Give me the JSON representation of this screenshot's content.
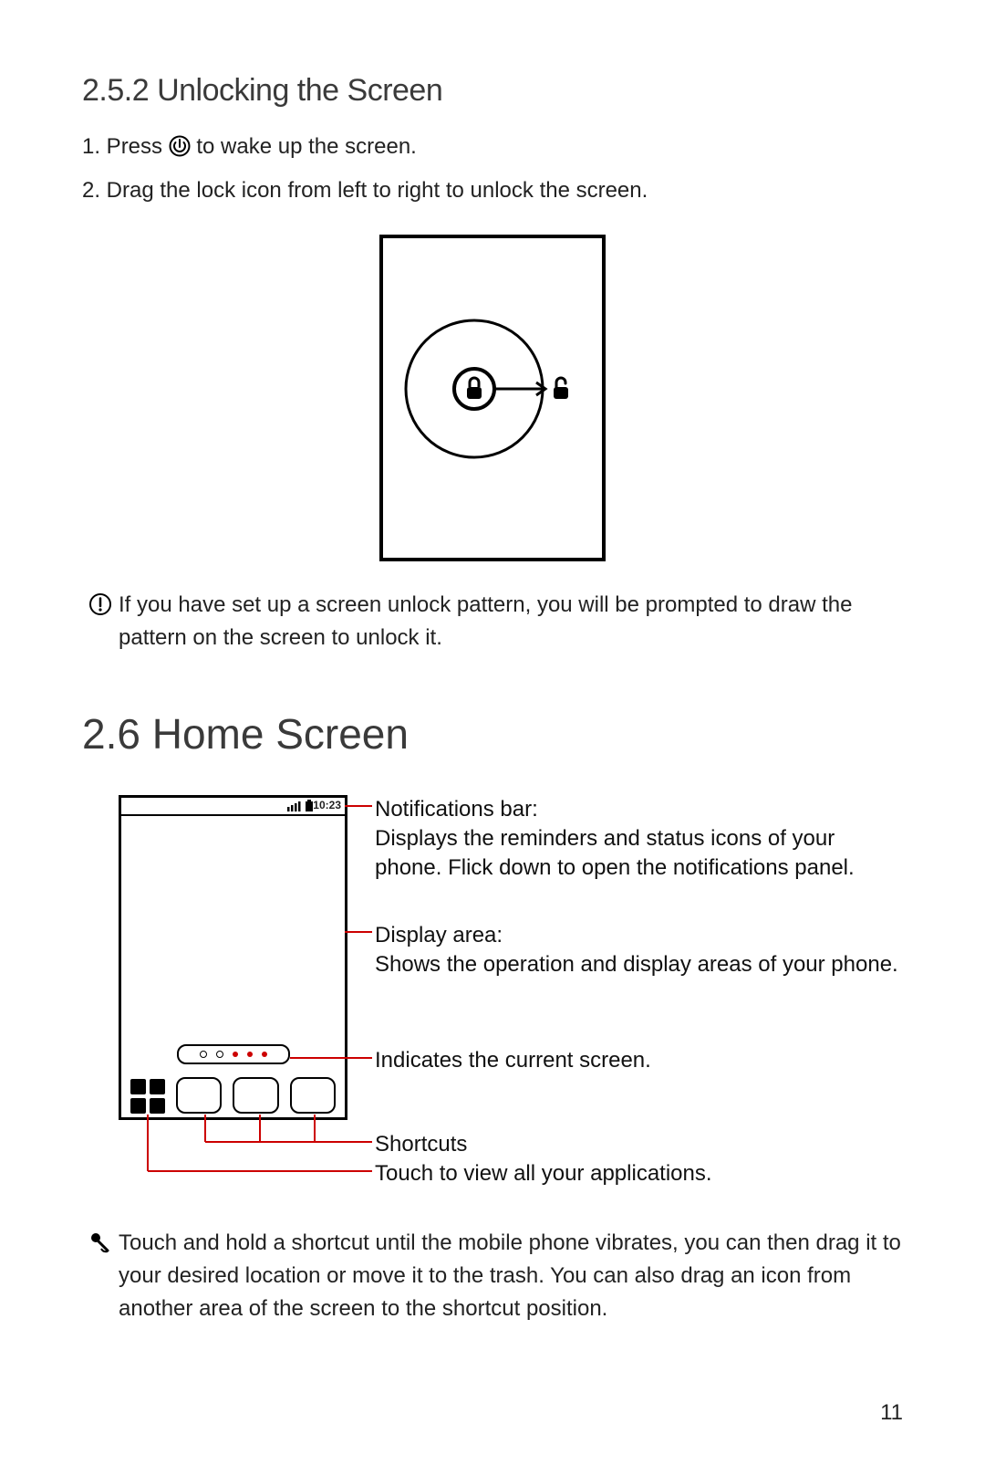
{
  "section1": {
    "heading": "2.5.2  Unlocking the Screen",
    "step1_prefix": "1. Press ",
    "step1_suffix": " to wake up the screen.",
    "step2": "2. Drag the lock icon from left to right to unlock the screen.",
    "note": "If you have set up a screen unlock pattern, you will be prompted to draw the pattern on the screen to unlock it."
  },
  "section2": {
    "heading": "2.6  Home Screen",
    "status_time": "10:23",
    "labels": {
      "notifications_title": "Notifications bar:",
      "notifications_body": "Displays the reminders and status icons of your phone. Flick down to open the notifications panel.",
      "display_title": "Display area:",
      "display_body": "Shows the operation and display areas of your phone.",
      "indicator": "Indicates the current screen.",
      "shortcuts": "Shortcuts",
      "apps": "Touch to view all your applications."
    },
    "tip": "Touch and hold a shortcut until the mobile phone vibrates, you can then drag it to your desired location or move it to the trash. You can also drag an icon from another area of the screen to the shortcut position."
  },
  "page_number": "11"
}
